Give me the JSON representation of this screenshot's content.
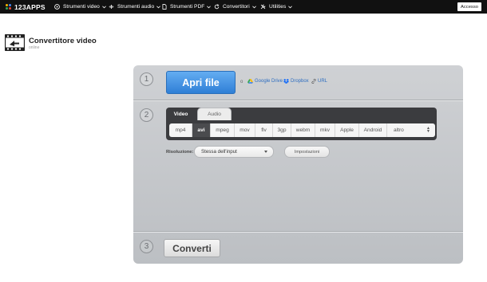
{
  "nav": {
    "logo_text": "123APPS",
    "items": [
      {
        "label": "Strumenti video",
        "icon": "play-circle-icon"
      },
      {
        "label": "Strumenti audio",
        "icon": "waveform-icon"
      },
      {
        "label": "Strumenti PDF",
        "icon": "document-icon"
      },
      {
        "label": "Convertitori",
        "icon": "refresh-icon"
      },
      {
        "label": "Utilities",
        "icon": "tools-icon"
      }
    ],
    "login_label": "Accesso"
  },
  "app": {
    "title": "Convertitore video",
    "subtitle": "online"
  },
  "steps": {
    "one": "1",
    "two": "2",
    "three": "3"
  },
  "upload": {
    "open_label": "Apri file",
    "or_label": "o",
    "sources": [
      "Google Drive",
      "Dropbox",
      "URL"
    ]
  },
  "tabs": {
    "video": "Video",
    "audio": "Audio",
    "active": "Video"
  },
  "formats": {
    "items": [
      "mp4",
      "avi",
      "mpeg",
      "mov",
      "flv",
      "3gp",
      "webm",
      "mkv",
      "Apple",
      "Android",
      "altro"
    ],
    "selected": "avi"
  },
  "options": {
    "resolution_label": "Risoluzione:",
    "resolution_value": "Stessa dell'input",
    "settings_label": "Impostazioni"
  },
  "convert": {
    "label": "Converti"
  },
  "colors": {
    "nav_bg": "#111111",
    "accent_blue": "#3d8fe3",
    "panel_bg": "#c6c8cb",
    "tab_dark": "#3b3c3f",
    "link_blue": "#2d6dc0"
  }
}
